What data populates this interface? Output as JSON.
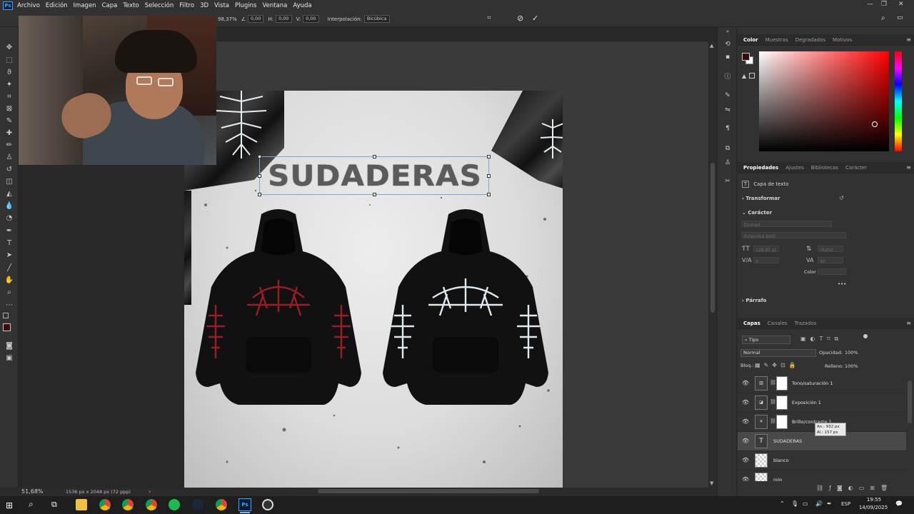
{
  "app": {
    "logo": "Ps"
  },
  "menu": [
    "Archivo",
    "Edición",
    "Imagen",
    "Capa",
    "Texto",
    "Selección",
    "Filtro",
    "3D",
    "Vista",
    "Plugins",
    "Ventana",
    "Ayuda"
  ],
  "window_controls": {
    "minimize": "—",
    "restore": "❐",
    "close": "✕"
  },
  "options_bar": {
    "scale": "98,37%",
    "angle_label": "∠",
    "angle": "0,00",
    "h_label": "H:",
    "h_value": "0,00",
    "v_label": "V:",
    "v_value": "0,00",
    "interp_label": "Interpolación:",
    "interp_value": "Bicúbica",
    "cancel_glyph": "⊘",
    "commit_glyph": "✓"
  },
  "canvas": {
    "headline": "SUDADERAS"
  },
  "status": {
    "zoom": "51,68%",
    "doc_info": "1536 px x 2048 px (72 ppp)",
    "arrow": "›"
  },
  "color_panel": {
    "tabs": [
      "Color",
      "Muestras",
      "Degradados",
      "Motivos"
    ],
    "foreground": "#3b0a0c",
    "background": "#ffffff"
  },
  "properties_panel": {
    "tabs": [
      "Propiedades",
      "Ajustes",
      "Bibliotecas",
      "Carácter"
    ],
    "layer_type": "Capa de texto",
    "section_transform": "Transformar",
    "section_character": "Carácter",
    "font_family": "Druhed",
    "font_style": "Extended Bold",
    "font_size": "128,95 pt",
    "leading": "(Auto)",
    "kerning": "0",
    "tracking": "40",
    "color_label": "Color",
    "more": "•••",
    "section_paragraph": "Párrafo"
  },
  "layers_panel": {
    "tabs": [
      "Capas",
      "Canales",
      "Trazados"
    ],
    "filter_kind": "Tipo",
    "blend_mode": "Normal",
    "opacity_label": "Opacidad:",
    "opacity": "100%",
    "lock_label": "Bloq.:",
    "fill_label": "Relleno:",
    "fill": "100%",
    "layers": [
      {
        "name": "Tono/saturación 1",
        "kind": "adjustment",
        "icon": "▥"
      },
      {
        "name": "Exposición 1",
        "kind": "adjustment",
        "icon": "◪"
      },
      {
        "name": "Brillo/contraste 1",
        "kind": "adjustment",
        "icon": "☀"
      },
      {
        "name": "SUDADERAS",
        "kind": "text",
        "icon": "T",
        "selected": true
      },
      {
        "name": "blanco",
        "kind": "pixel",
        "icon": ""
      },
      {
        "name": "rojo",
        "kind": "pixel",
        "icon": ""
      }
    ],
    "tooltip": {
      "width": "An.: 932 px",
      "height": "Al.: 157 px"
    }
  },
  "taskbar": {
    "language": "ESP",
    "time": "19:55",
    "date": "14/09/2025"
  },
  "colors": {
    "hoodie_left_print": "#9b1c24",
    "hoodie_right_print": "#dfe9f0",
    "accent": "#31a8ff"
  }
}
